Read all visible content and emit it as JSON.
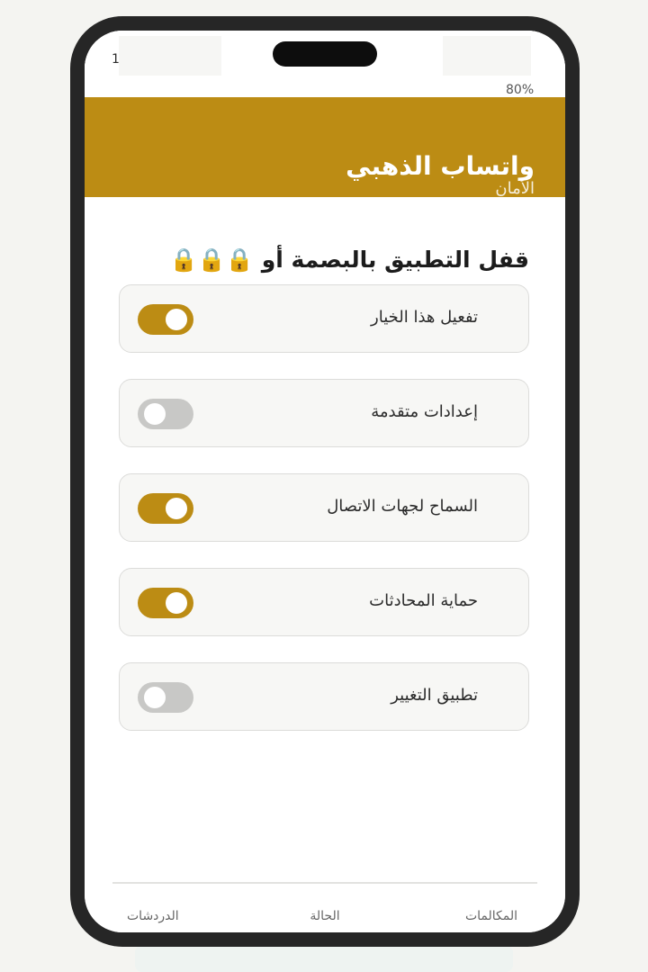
{
  "status_bar": {
    "time": "1",
    "battery": "80%"
  },
  "header": {
    "title": "واتساب الذهبي",
    "subtitle": "الأمان"
  },
  "section": {
    "title": "قفل التطبيق بالبصمة أو 🔒🔒🔒"
  },
  "settings": [
    {
      "label": "تفعيل هذا الخيار",
      "enabled": true
    },
    {
      "label": "إعدادات متقدمة",
      "enabled": false
    },
    {
      "label": "السماح لجهات الاتصال",
      "enabled": true
    },
    {
      "label": "حماية المحادثات",
      "enabled": true
    },
    {
      "label": "تطبيق التغيير",
      "enabled": false
    }
  ],
  "bottom_nav": {
    "calls": "المكالمات",
    "status": "الحالة",
    "chats": "الدردشات"
  },
  "colors": {
    "accent": "#bc8c14",
    "toggle_off": "#c8c8c6",
    "frame": "#262626"
  }
}
